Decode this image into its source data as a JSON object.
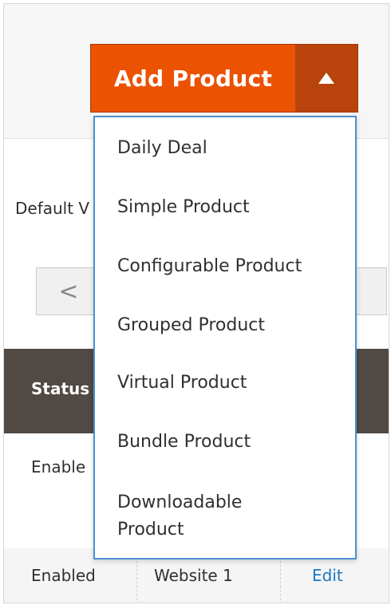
{
  "add_product": {
    "label": "Add Product",
    "toggle_icon": "caret-up-icon",
    "button_color": "#eb5202",
    "toggle_color": "#b8430c"
  },
  "filter": {
    "scope_label": "Default V"
  },
  "pager": {
    "prev_symbol": "<"
  },
  "grid": {
    "header_status": "Status",
    "rows": [
      {
        "status": "Enable"
      },
      {
        "status": "Enabled",
        "website": "Website 1",
        "action": "Edit"
      }
    ]
  },
  "dropdown": {
    "border_color": "#4a90d0",
    "items": [
      {
        "label": "Daily Deal"
      },
      {
        "label": "Simple Product"
      },
      {
        "label": "Configurable Product"
      },
      {
        "label": "Grouped Product"
      },
      {
        "label": "Virtual Product"
      },
      {
        "label": "Bundle Product"
      },
      {
        "label": "Downloadable Product",
        "line1": "Downloadable",
        "line2": "Product"
      }
    ]
  }
}
